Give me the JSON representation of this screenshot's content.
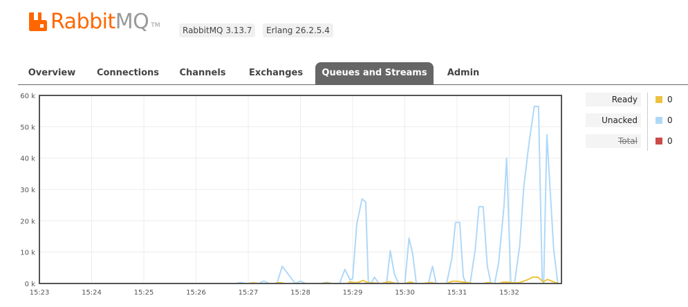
{
  "header": {
    "logo_rabbit": "Rabbit",
    "logo_mq": "MQ",
    "logo_tm": "TM",
    "rabbitmq_version": "RabbitMQ 3.13.7",
    "erlang_version": "Erlang 26.2.5.4"
  },
  "tabs": [
    {
      "label": "Overview",
      "active": false
    },
    {
      "label": "Connections",
      "active": false
    },
    {
      "label": "Channels",
      "active": false
    },
    {
      "label": "Exchanges",
      "active": false
    },
    {
      "label": "Queues and Streams",
      "active": true
    },
    {
      "label": "Admin",
      "active": false
    }
  ],
  "colors": {
    "brand": "#ff6600",
    "ready": "#edc240",
    "unacked": "#afd8f8",
    "total": "#cb4b4b",
    "active_tab": "#666666"
  },
  "legend": [
    {
      "label": "Ready",
      "value": "0",
      "color": "#edc240",
      "struck": false
    },
    {
      "label": "Unacked",
      "value": "0",
      "color": "#afd8f8",
      "struck": false
    },
    {
      "label": "Total",
      "value": "0",
      "color": "#cb4b4b",
      "struck": true
    }
  ],
  "chart_data": {
    "type": "line",
    "x_unit": "minutes",
    "xlim": [
      15.383,
      25.383
    ],
    "ylim": [
      0,
      60000
    ],
    "x_ticks": [
      {
        "v": 0,
        "label": "15:23"
      },
      {
        "v": 1,
        "label": "15:24"
      },
      {
        "v": 2,
        "label": "15:25"
      },
      {
        "v": 3,
        "label": "15:26"
      },
      {
        "v": 4,
        "label": "15:27"
      },
      {
        "v": 5,
        "label": "15:28"
      },
      {
        "v": 6,
        "label": "15:29"
      },
      {
        "v": 7,
        "label": "15:30"
      },
      {
        "v": 8,
        "label": "15:31"
      },
      {
        "v": 9,
        "label": "15:32"
      }
    ],
    "y_ticks": [
      {
        "v": 0,
        "label": "0 k"
      },
      {
        "v": 10000,
        "label": "10 k"
      },
      {
        "v": 20000,
        "label": "20 k"
      },
      {
        "v": 30000,
        "label": "30 k"
      },
      {
        "v": 40000,
        "label": "40 k"
      },
      {
        "v": 50000,
        "label": "50 k"
      },
      {
        "v": 60000,
        "label": "60 k"
      }
    ],
    "grid": true,
    "legend_position": "right",
    "series": [
      {
        "name": "Unacked",
        "points": [
          [
            0,
            0
          ],
          [
            3.75,
            0
          ],
          [
            3.85,
            300
          ],
          [
            3.95,
            0
          ],
          [
            4.2,
            0
          ],
          [
            4.3,
            800
          ],
          [
            4.4,
            0
          ],
          [
            4.55,
            0
          ],
          [
            4.65,
            5500
          ],
          [
            4.8,
            2200
          ],
          [
            4.9,
            0
          ],
          [
            5,
            800
          ],
          [
            5.1,
            0
          ],
          [
            5.4,
            0
          ],
          [
            5.5,
            400
          ],
          [
            5.6,
            0
          ],
          [
            5.75,
            0
          ],
          [
            5.85,
            4500
          ],
          [
            5.95,
            1200
          ],
          [
            6,
            1500
          ],
          [
            6.08,
            19000
          ],
          [
            6.18,
            27000
          ],
          [
            6.25,
            26000
          ],
          [
            6.3,
            800
          ],
          [
            6.35,
            0
          ],
          [
            6.42,
            2000
          ],
          [
            6.5,
            0
          ],
          [
            6.65,
            0
          ],
          [
            6.72,
            10500
          ],
          [
            6.8,
            3000
          ],
          [
            6.88,
            0
          ],
          [
            7.0,
            0
          ],
          [
            7.08,
            14500
          ],
          [
            7.15,
            9500
          ],
          [
            7.22,
            0
          ],
          [
            7.45,
            0
          ],
          [
            7.53,
            5500
          ],
          [
            7.6,
            0
          ],
          [
            7.8,
            0
          ],
          [
            7.9,
            8000
          ],
          [
            7.97,
            19500
          ],
          [
            8.05,
            19500
          ],
          [
            8.12,
            2000
          ],
          [
            8.18,
            0
          ],
          [
            8.25,
            0
          ],
          [
            8.35,
            11000
          ],
          [
            8.42,
            24500
          ],
          [
            8.5,
            24500
          ],
          [
            8.58,
            5500
          ],
          [
            8.65,
            0
          ],
          [
            8.72,
            0
          ],
          [
            8.8,
            7000
          ],
          [
            8.9,
            25000
          ],
          [
            8.95,
            40000
          ],
          [
            9.03,
            0
          ],
          [
            9.1,
            0
          ],
          [
            9.2,
            12000
          ],
          [
            9.28,
            31000
          ],
          [
            9.38,
            45000
          ],
          [
            9.48,
            56500
          ],
          [
            9.56,
            56500
          ],
          [
            9.63,
            1500
          ],
          [
            9.66,
            0
          ],
          [
            9.72,
            47500
          ],
          [
            9.85,
            11000
          ],
          [
            9.93,
            0
          ],
          [
            10.03,
            0
          ],
          [
            10.12,
            1000
          ],
          [
            10.2,
            0
          ],
          [
            10.5,
            0
          ]
        ]
      },
      {
        "name": "Ready",
        "points": [
          [
            0,
            0
          ],
          [
            4.0,
            0
          ],
          [
            4.1,
            200
          ],
          [
            4.2,
            0
          ],
          [
            4.5,
            0
          ],
          [
            4.6,
            300
          ],
          [
            4.7,
            0
          ],
          [
            5.4,
            0
          ],
          [
            5.5,
            200
          ],
          [
            5.6,
            0
          ],
          [
            5.9,
            0
          ],
          [
            5.95,
            600
          ],
          [
            6.0,
            300
          ],
          [
            6.1,
            300
          ],
          [
            6.2,
            1000
          ],
          [
            6.3,
            200
          ],
          [
            6.4,
            200
          ],
          [
            6.55,
            0
          ],
          [
            6.7,
            600
          ],
          [
            6.8,
            100
          ],
          [
            6.9,
            0
          ],
          [
            7.0,
            0
          ],
          [
            7.1,
            500
          ],
          [
            7.2,
            0
          ],
          [
            7.35,
            0
          ],
          [
            7.5,
            300
          ],
          [
            7.6,
            0
          ],
          [
            7.8,
            0
          ],
          [
            7.9,
            700
          ],
          [
            8.0,
            700
          ],
          [
            8.1,
            500
          ],
          [
            8.2,
            300
          ],
          [
            8.3,
            0
          ],
          [
            8.5,
            0
          ],
          [
            8.6,
            300
          ],
          [
            8.7,
            0
          ],
          [
            8.8,
            0
          ],
          [
            8.9,
            500
          ],
          [
            9.0,
            400
          ],
          [
            9.1,
            200
          ],
          [
            9.2,
            300
          ],
          [
            9.35,
            1200
          ],
          [
            9.45,
            2000
          ],
          [
            9.55,
            2000
          ],
          [
            9.65,
            500
          ],
          [
            9.73,
            1300
          ],
          [
            9.85,
            500
          ],
          [
            9.95,
            0
          ],
          [
            10.5,
            0
          ]
        ]
      }
    ]
  }
}
